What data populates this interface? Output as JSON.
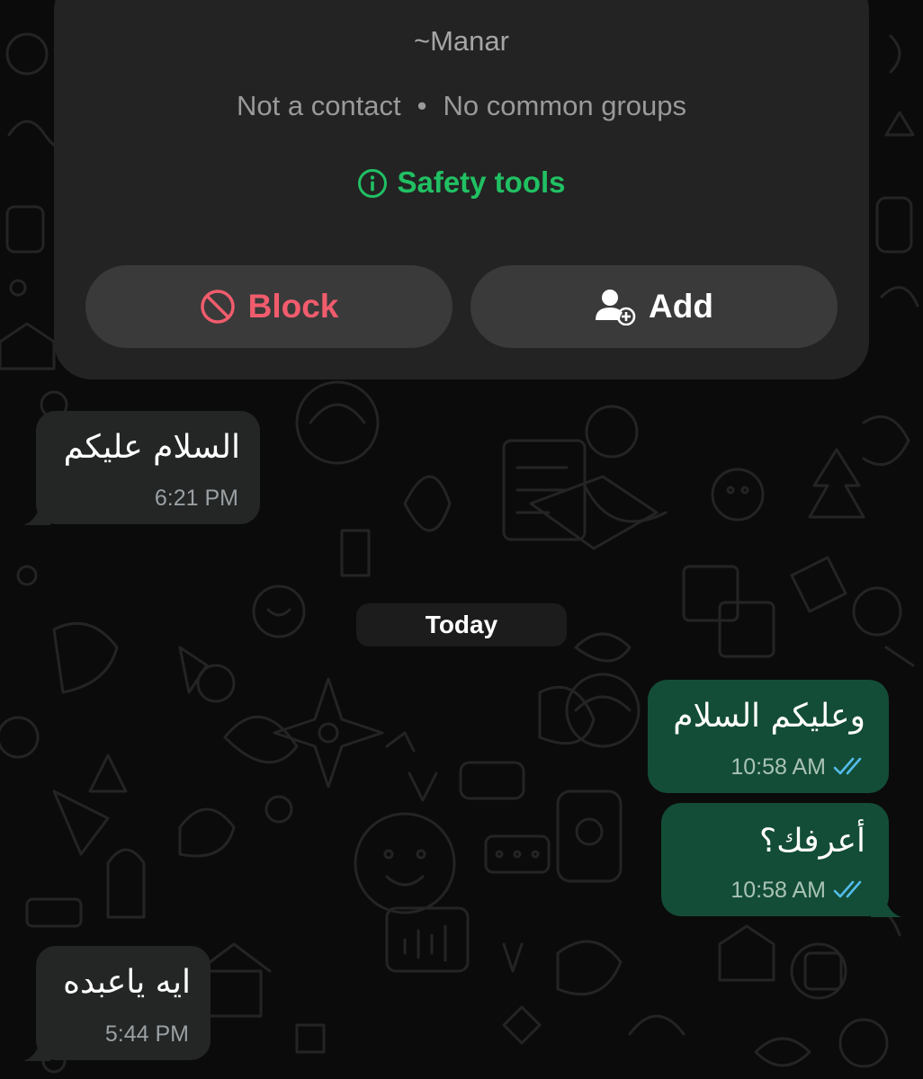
{
  "contact": {
    "name": "~Manar",
    "status_contact": "Not a contact",
    "separator": "•",
    "status_groups": "No common groups",
    "safety_tools": "Safety tools",
    "block_label": "Block",
    "add_label": "Add"
  },
  "date_divider": "Today",
  "messages": [
    {
      "direction": "incoming",
      "text": "السلام عليكم",
      "time": "6:21 PM"
    },
    {
      "direction": "outgoing",
      "text": "وعليكم السلام",
      "time": "10:58 AM",
      "status": "read"
    },
    {
      "direction": "outgoing",
      "text": "أعرفك؟",
      "time": "10:58 AM",
      "status": "read"
    },
    {
      "direction": "incoming",
      "text": "ايه ياعبده",
      "time": "5:44 PM"
    }
  ],
  "colors": {
    "background": "#0b0b0b",
    "card": "#232323",
    "accent_green": "#21c063",
    "block_red": "#f15c6d",
    "incoming_bubble": "#242626",
    "outgoing_bubble": "#144d37",
    "read_ticks": "#53bdeb"
  },
  "icons": {
    "safety": "info-circle-icon",
    "block": "block-circle-icon",
    "add": "add-contact-icon",
    "ticks": "double-check-icon",
    "wallpaper": "doodle-pattern"
  }
}
